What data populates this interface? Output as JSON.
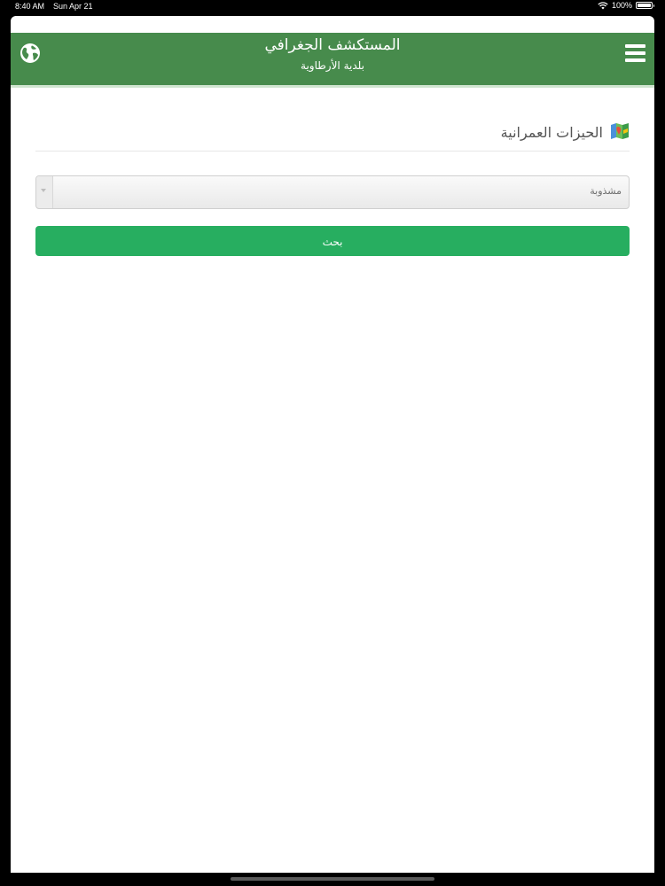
{
  "status_bar": {
    "time": "8:40 AM",
    "date": "Sun Apr 21",
    "battery": "100%",
    "battery_level": 1.0
  },
  "navbar": {
    "title": "المستكشف الجغرافي",
    "subtitle": "بلدية الأرطاوية",
    "left_icon": "globe-icon",
    "right_icon": "hamburger-menu-icon",
    "color": "#478b4c"
  },
  "section": {
    "title": "الحيزات العمرانية",
    "icon": "map-icon"
  },
  "filter": {
    "selected": "مشذوبة"
  },
  "search_button": {
    "label": "بحث",
    "color": "#27ae60"
  }
}
